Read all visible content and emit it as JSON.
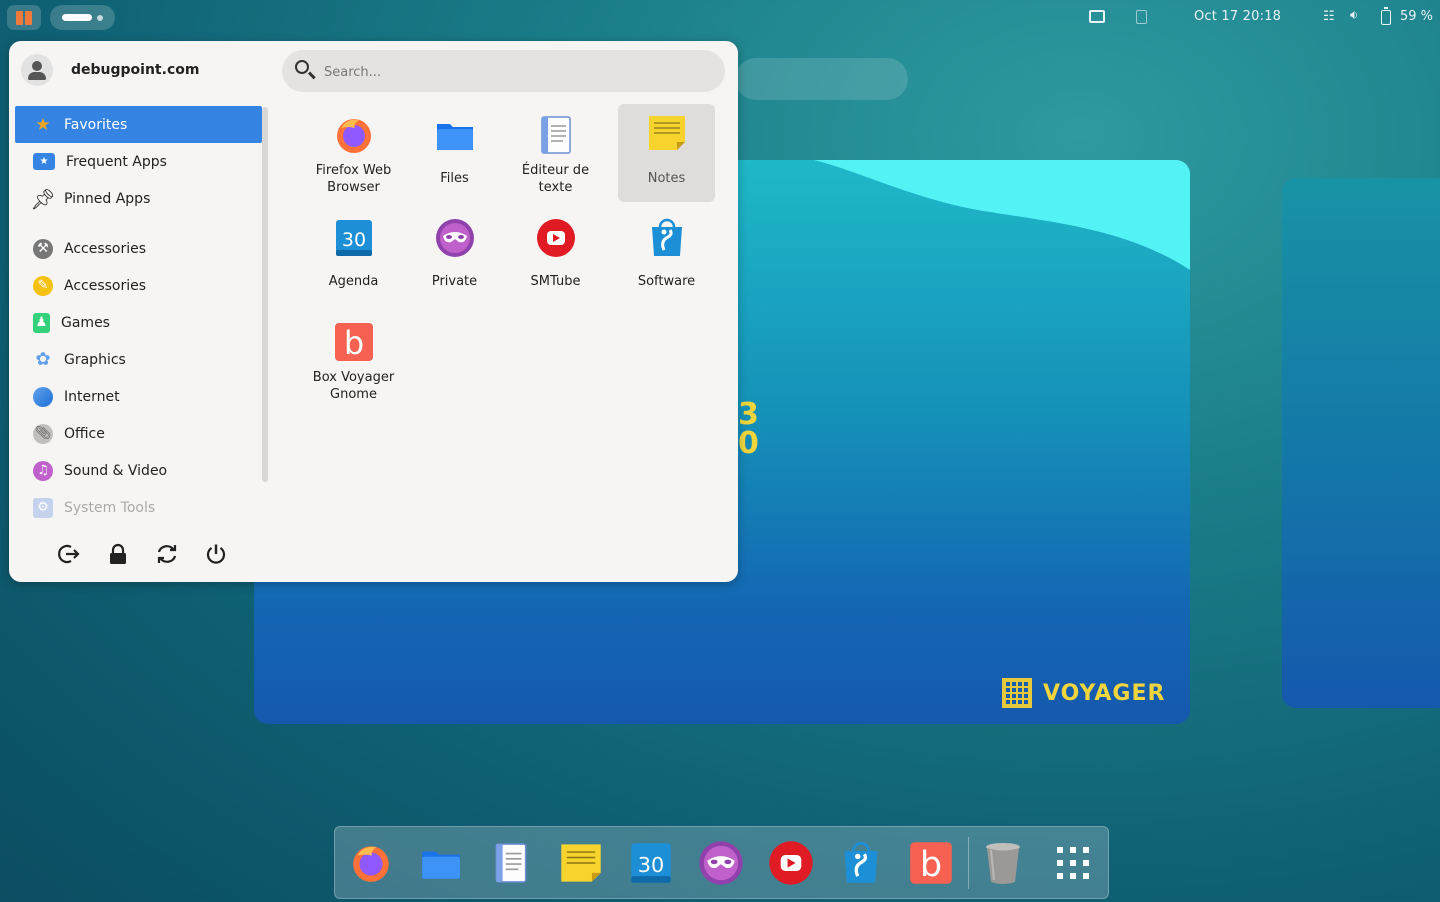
{
  "topbar": {
    "clock": "Oct 17  20:18",
    "battery": "59 %"
  },
  "menu": {
    "user": "debugpoint.com",
    "search_placeholder": "Search...",
    "categories": [
      {
        "label": "Favorites",
        "icon": "star-icon",
        "color": "#f5a623"
      },
      {
        "label": "Frequent Apps",
        "icon": "star-window-icon",
        "color": "#3584e4"
      },
      {
        "label": "Pinned Apps",
        "icon": "pin-icon",
        "color": "#222222"
      },
      {
        "label": "Accessories",
        "icon": "tools-icon",
        "color": "#888888"
      },
      {
        "label": "Accessories",
        "icon": "pencil-icon",
        "color": "#f5c211"
      },
      {
        "label": "Games",
        "icon": "gamepad-icon",
        "color": "#33d17a"
      },
      {
        "label": "Graphics",
        "icon": "flower-icon",
        "color": "#62a0ea"
      },
      {
        "label": "Internet",
        "icon": "globe-icon",
        "color": "#1c71d8"
      },
      {
        "label": "Office",
        "icon": "paperclip-icon",
        "color": "#9a9996"
      },
      {
        "label": "Sound & Video",
        "icon": "music-icon",
        "color": "#c061cb"
      },
      {
        "label": "System Tools",
        "icon": "gear-icon",
        "color": "#a0b4e0"
      }
    ],
    "apps": [
      {
        "label_line1": "Firefox Web",
        "label_line2": "Browser",
        "icon": "firefox-icon"
      },
      {
        "label_line1": "Files",
        "label_line2": "",
        "icon": "folder-icon"
      },
      {
        "label_line1": "Éditeur de",
        "label_line2": "texte",
        "icon": "text-editor-icon"
      },
      {
        "label_line1": "Notes",
        "label_line2": "",
        "icon": "notes-icon"
      },
      {
        "label_line1": "Agenda",
        "label_line2": "",
        "icon": "calendar-icon",
        "badge": "30"
      },
      {
        "label_line1": "Private",
        "label_line2": "",
        "icon": "private-mask-icon"
      },
      {
        "label_line1": "SMTube",
        "label_line2": "",
        "icon": "smtube-icon"
      },
      {
        "label_line1": "Software",
        "label_line2": "",
        "icon": "software-store-icon"
      },
      {
        "label_line1": "Box Voyager",
        "label_line2": "Gnome",
        "icon": "box-voyager-icon",
        "badge": "b"
      }
    ],
    "session_buttons": [
      "logout-icon",
      "lock-icon",
      "restart-icon",
      "power-icon"
    ]
  },
  "wallpaper": {
    "brand": "VOYAGER",
    "peek_text_1": "3",
    "peek_text_2": "0"
  },
  "dock": {
    "items": [
      "firefox-icon",
      "folder-icon",
      "text-editor-icon",
      "notes-icon",
      "calendar-icon",
      "private-mask-icon",
      "smtube-icon",
      "software-store-icon",
      "box-voyager-icon",
      "trash-icon",
      "app-grid-icon"
    ],
    "calendar_badge": "30",
    "box_badge": "b"
  },
  "colors": {
    "accent": "#3584e4",
    "menu_bg": "#f6f5f4",
    "brand_yellow": "#f0d53d"
  }
}
